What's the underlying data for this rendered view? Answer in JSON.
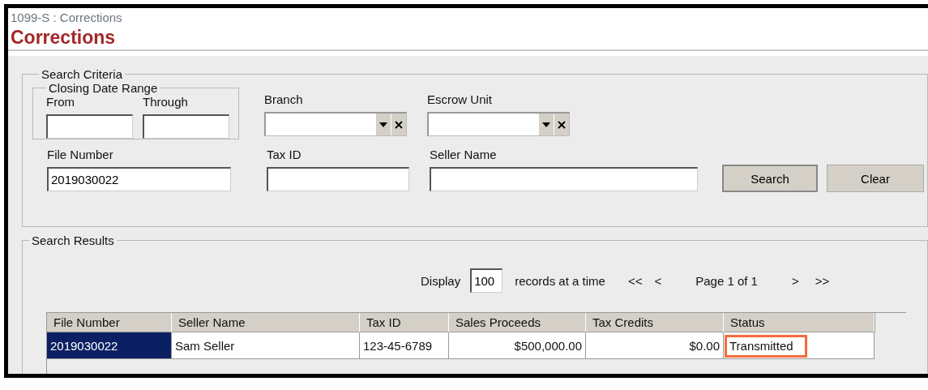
{
  "window": {
    "breadcrumb": "1099-S : Corrections",
    "title": "Corrections"
  },
  "search_criteria": {
    "legend": "Search Criteria",
    "date_range": {
      "legend": "Closing Date Range",
      "from": {
        "label": "From"
      },
      "through": {
        "label": "Through"
      }
    },
    "branch": {
      "label": "Branch"
    },
    "escrow_unit": {
      "label": "Escrow Unit"
    },
    "file_number": {
      "label": "File Number",
      "value": "2019030022"
    },
    "tax_id": {
      "label": "Tax ID"
    },
    "seller_name": {
      "label": "Seller Name"
    },
    "buttons": [
      "Search",
      "Clear"
    ]
  },
  "search_results": {
    "legend": "Search Results",
    "pager": {
      "display_label": "Display",
      "page_size": "100",
      "suffix": "records at a time",
      "first": "<<",
      "prev": "<",
      "page_text": "Page 1 of 1",
      "next": ">",
      "last": ">>"
    },
    "table": {
      "columns": [
        "File Number",
        "Seller Name",
        "Tax ID",
        "Sales Proceeds",
        "Tax Credits",
        "Status"
      ],
      "rows": [
        {
          "cells": [
            "2019030022",
            "Sam Seller",
            "123-45-6789",
            "$500,000.00",
            "$0.00",
            "Transmitted"
          ],
          "selected": true,
          "status_highlighted": true
        }
      ]
    }
  }
}
